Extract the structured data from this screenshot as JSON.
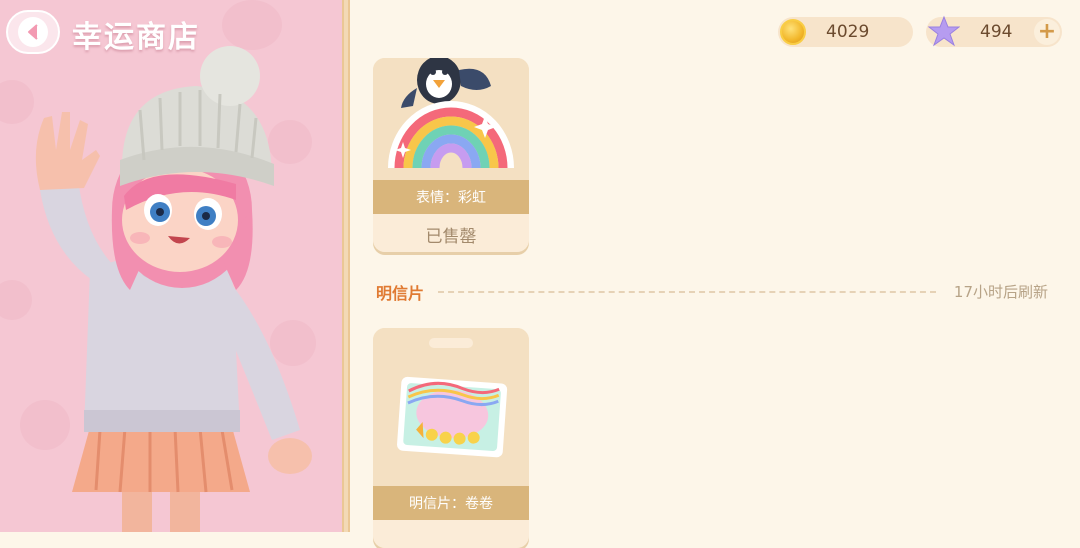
{
  "header": {
    "title": "幸运商店"
  },
  "currency": {
    "coins": "4029",
    "stars": "494",
    "coin_color": "#f2b72a",
    "star_color": "#b69cf0"
  },
  "items": [
    {
      "name": "表情：彩虹",
      "status": "已售罄"
    },
    {
      "name": "明信片：卷卷"
    }
  ],
  "section": {
    "title": "明信片",
    "refresh": "17小时后刷新"
  },
  "colors": {
    "panel_pink": "#f5c7d3",
    "background": "#fdf6e9",
    "band_gold": "#d9b57b",
    "section_orange": "#e07a32"
  }
}
